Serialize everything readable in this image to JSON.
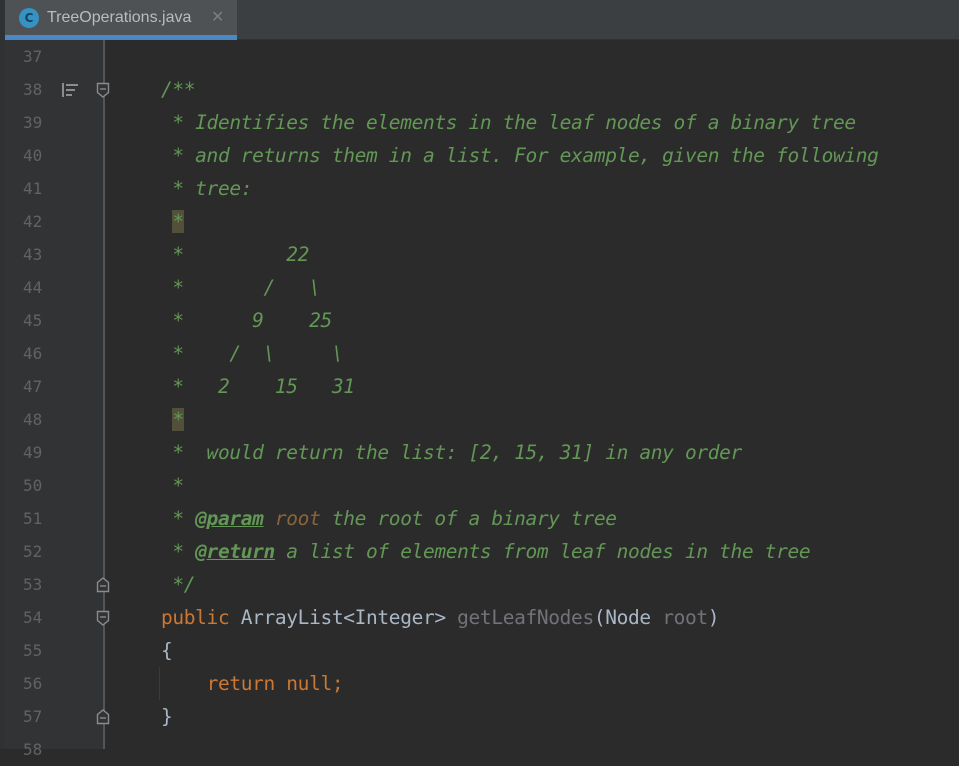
{
  "tab": {
    "icon": "C",
    "filename": "TreeOperations.java",
    "close": "✕",
    "accent": "#4a88c7"
  },
  "editor": {
    "lines": [
      {
        "n": "37",
        "tokens": []
      },
      {
        "n": "38",
        "tokens": [
          {
            "t": "/**",
            "c": "c-doc"
          }
        ]
      },
      {
        "n": "39",
        "tokens": [
          {
            "t": " * Identifies the elements in the leaf nodes of a binary tree",
            "c": "c-doc"
          }
        ]
      },
      {
        "n": "40",
        "tokens": [
          {
            "t": " * and returns them in a list. For example, given the following",
            "c": "c-doc"
          }
        ]
      },
      {
        "n": "41",
        "tokens": [
          {
            "t": " * tree:",
            "c": "c-doc"
          }
        ]
      },
      {
        "n": "42",
        "tokens": [
          {
            "t": " ",
            "c": "c-doc"
          },
          {
            "t": "*",
            "c": "c-doc hl"
          }
        ]
      },
      {
        "n": "43",
        "tokens": [
          {
            "t": " *         22",
            "c": "c-doc"
          }
        ]
      },
      {
        "n": "44",
        "tokens": [
          {
            "t": " *       /   \\",
            "c": "c-doc"
          }
        ]
      },
      {
        "n": "45",
        "tokens": [
          {
            "t": " *      9    25",
            "c": "c-doc"
          }
        ]
      },
      {
        "n": "46",
        "tokens": [
          {
            "t": " *    /  \\     \\",
            "c": "c-doc"
          }
        ]
      },
      {
        "n": "47",
        "tokens": [
          {
            "t": " *   2    15   31",
            "c": "c-doc"
          }
        ]
      },
      {
        "n": "48",
        "tokens": [
          {
            "t": " ",
            "c": "c-doc"
          },
          {
            "t": "*",
            "c": "c-doc hl"
          }
        ]
      },
      {
        "n": "49",
        "tokens": [
          {
            "t": " *  would return the list: [2, 15, 31] in any order",
            "c": "c-doc"
          }
        ]
      },
      {
        "n": "50",
        "tokens": [
          {
            "t": " *",
            "c": "c-doc"
          }
        ]
      },
      {
        "n": "51",
        "tokens": [
          {
            "t": " * ",
            "c": "c-doc"
          },
          {
            "t": "@param",
            "c": "c-tag"
          },
          {
            "t": " ",
            "c": "c-doc"
          },
          {
            "t": "root",
            "c": "c-pname"
          },
          {
            "t": " the root of a binary tree",
            "c": "c-doc"
          }
        ]
      },
      {
        "n": "52",
        "tokens": [
          {
            "t": " * ",
            "c": "c-doc"
          },
          {
            "t": "@return",
            "c": "c-tag"
          },
          {
            "t": " a list of elements from leaf nodes in the tree",
            "c": "c-doc"
          }
        ]
      },
      {
        "n": "53",
        "tokens": [
          {
            "t": " */",
            "c": "c-doc"
          }
        ]
      },
      {
        "n": "54",
        "tokens": [
          {
            "t": "public ",
            "c": "c-kw"
          },
          {
            "t": "ArrayList<Integer> ",
            "c": "c-type"
          },
          {
            "t": "getLeafNodes",
            "c": "c-unused"
          },
          {
            "t": "(Node ",
            "c": "c-type"
          },
          {
            "t": "root",
            "c": "c-unused"
          },
          {
            "t": ")",
            "c": "c-type"
          }
        ]
      },
      {
        "n": "55",
        "tokens": [
          {
            "t": "{",
            "c": "c-type"
          }
        ]
      },
      {
        "n": "56",
        "tokens": [
          {
            "t": "    ",
            "c": "c-type"
          },
          {
            "t": "return null;",
            "c": "c-kw"
          }
        ]
      },
      {
        "n": "57",
        "tokens": [
          {
            "t": "}",
            "c": "c-type"
          }
        ]
      },
      {
        "n": "58",
        "tokens": []
      }
    ],
    "gutter_icons": {
      "38": [
        "todo-list-icon",
        "fold-start-icon"
      ],
      "53": [
        "fold-end-icon"
      ],
      "54": [
        "fold-start-icon"
      ],
      "57": [
        "fold-end-icon"
      ]
    }
  }
}
